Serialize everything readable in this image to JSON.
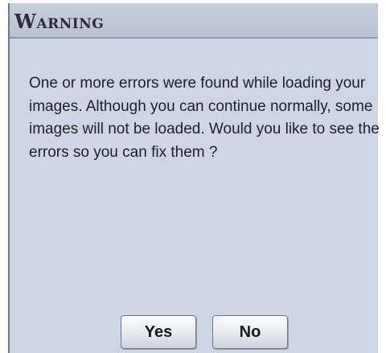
{
  "dialog": {
    "title": "Warning",
    "message": "One or more errors were found while loading your images. Although you can continue normally, some images will not be loaded. Would you like to see the errors so you can fix them ?",
    "buttons": {
      "yes_label": "Yes",
      "no_label": "No"
    }
  }
}
